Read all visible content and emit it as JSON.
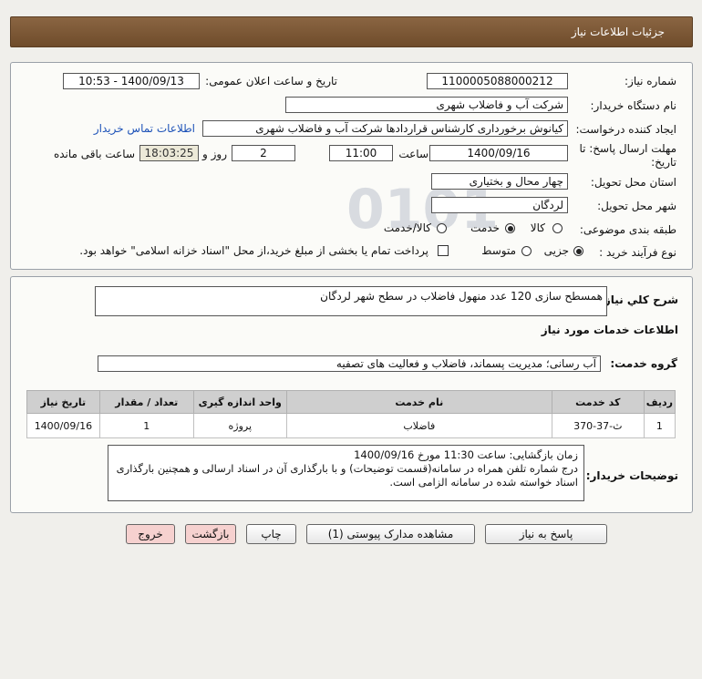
{
  "header": {
    "title": "جزئیات اطلاعات نیاز"
  },
  "form": {
    "need_number": {
      "label": "شماره نیاز:",
      "value": "1100005088000212"
    },
    "announce": {
      "label": "تاریخ و ساعت اعلان عمومی:",
      "value": "1400/09/13 - 10:53"
    },
    "buyer": {
      "label": "نام دستگاه خریدار:",
      "value": "شرکت آب و فاضلاب شهری"
    },
    "creator": {
      "label": "ایجاد کننده درخواست:",
      "value": "کیانوش برخورداری کارشناس قراردادها شرکت آب و فاضلاب شهری",
      "contact_link": "اطلاعات تماس خریدار"
    },
    "deadline": {
      "label_line1": "مهلت ارسال پاسخ: تا",
      "label_line2": "تاریخ:",
      "date": "1400/09/16",
      "time_label": "ساعت",
      "time": "11:00",
      "days": "2",
      "days_label": "روز و",
      "remaining": "18:03:25",
      "remaining_label": "ساعت باقی مانده"
    },
    "province": {
      "label": "استان محل تحویل:",
      "value": "چهار محال و بختیاری"
    },
    "city": {
      "label": "شهر محل تحویل:",
      "value": "لردگان"
    },
    "category": {
      "label": "طبقه بندی موضوعی:",
      "options": [
        "کالا",
        "خدمت",
        "کالا/خدمت"
      ],
      "selected": "خدمت"
    },
    "process": {
      "label": "نوع فرآیند خرید :",
      "options": [
        "جزیی",
        "متوسط"
      ],
      "selected": "جزیی",
      "checkbox_text": "پرداخت تمام یا بخشی از مبلغ خرید،از محل \"اسناد خزانه اسلامی\" خواهد بود."
    }
  },
  "description": {
    "label": "شرح کلي نياز:",
    "value": "همسطح سازی 120 عدد منهول فاضلاب در سطح شهر لردگان"
  },
  "services": {
    "section_title": "اطلاعات خدمات مورد نیاز",
    "group_label": "گروه خدمت:",
    "group_value": "آب رسانی؛ مدیریت پسماند، فاضلاب و فعالیت های تصفیه",
    "columns": [
      "ردیف",
      "کد خدمت",
      "نام خدمت",
      "واحد اندازه گیری",
      "تعداد / مقدار",
      "تاریخ نیاز"
    ],
    "rows": [
      [
        "1",
        "ث-37-370",
        "فاضلاب",
        "پروژه",
        "1",
        "1400/09/16"
      ]
    ]
  },
  "buyer_notes": {
    "label": "توضیحات خریدار:",
    "text": "زمان بازگشایی: ساعت 11:30 مورخ 1400/09/16\nدرج شماره تلفن همراه در سامانه(قسمت توضیحات) و با بارگذاری آن در اسناد ارسالی و همچنین بارگذاری اسناد خواسته شده در سامانه الزامی است."
  },
  "buttons": {
    "reply": "پاسخ به نیاز",
    "view_docs": "مشاهده مدارک پیوستی (1)",
    "print": "چاپ",
    "back": "بازگشت",
    "exit": "خروج"
  },
  "colors": {
    "header": "#7a5634",
    "link": "#1d52b8",
    "pink_button": "#f6d1cf"
  }
}
